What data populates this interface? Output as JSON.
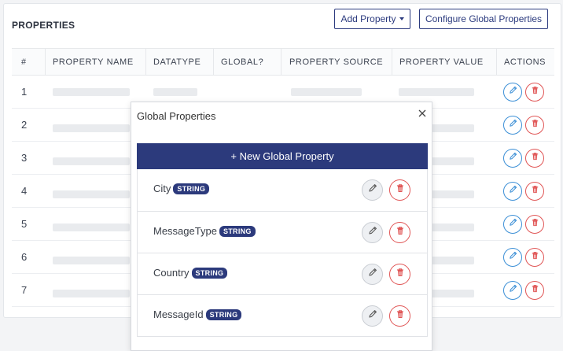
{
  "page": {
    "title": "PROPERTIES",
    "add_property_label": "Add Property",
    "configure_label": "Configure Global Properties"
  },
  "table": {
    "headers": [
      "#",
      "PROPERTY NAME",
      "DATATYPE",
      "GLOBAL?",
      "PROPERTY SOURCE",
      "PROPERTY VALUE",
      "ACTIONS"
    ],
    "rows": [
      {
        "num": "1"
      },
      {
        "num": "2"
      },
      {
        "num": "3"
      },
      {
        "num": "4"
      },
      {
        "num": "5"
      },
      {
        "num": "6"
      },
      {
        "num": "7"
      }
    ]
  },
  "modal": {
    "title": "Global Properties",
    "new_button_label": "+ New Global Property",
    "properties": [
      {
        "name": "City",
        "type": "STRING"
      },
      {
        "name": "MessageType",
        "type": "STRING"
      },
      {
        "name": "Country",
        "type": "STRING"
      },
      {
        "name": "MessageId",
        "type": "STRING"
      }
    ]
  },
  "colors": {
    "primary": "#2c3a7c",
    "edit_blue": "#3b8fd6",
    "delete_red": "#e05555"
  },
  "icons": {
    "edit": "pencil-icon",
    "delete": "trash-icon",
    "close": "close-icon",
    "dropdown": "caret-down-icon"
  }
}
